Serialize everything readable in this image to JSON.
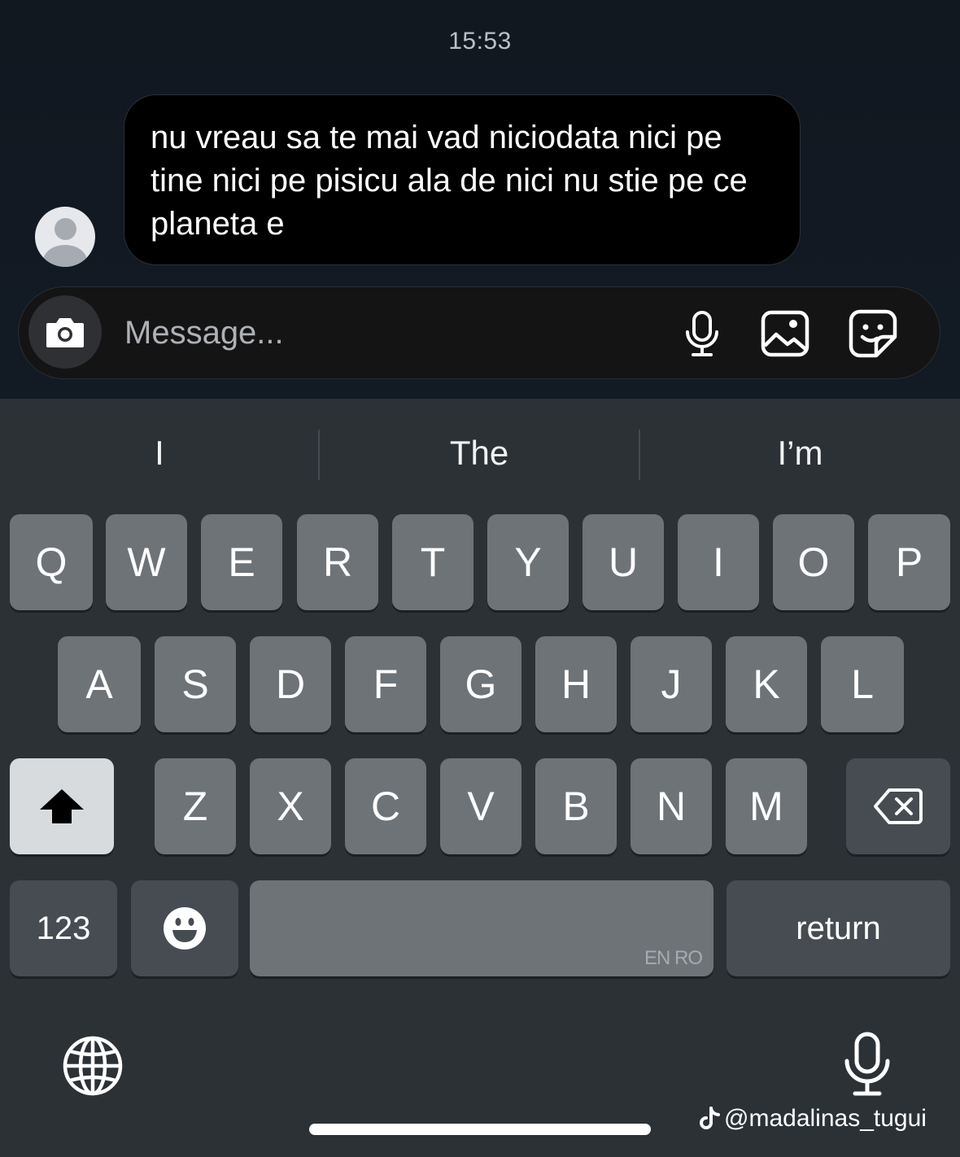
{
  "chat": {
    "timestamp": "15:53",
    "message_text": "nu vreau sa te mai vad niciodata nici pe tine nici pe pisicu ala de nici nu stie pe ce planeta e"
  },
  "composer": {
    "placeholder": "Message...",
    "icons": [
      "camera-icon",
      "microphone-icon",
      "image-icon",
      "sticker-icon"
    ]
  },
  "keyboard": {
    "suggestions": [
      "I",
      "The",
      "I’m"
    ],
    "row1": [
      "Q",
      "W",
      "E",
      "R",
      "T",
      "Y",
      "U",
      "I",
      "O",
      "P"
    ],
    "row2": [
      "A",
      "S",
      "D",
      "F",
      "G",
      "H",
      "J",
      "K",
      "L"
    ],
    "row3": [
      "Z",
      "X",
      "C",
      "V",
      "B",
      "N",
      "M"
    ],
    "numbers_label": "123",
    "space_language": "EN RO",
    "return_label": "return"
  },
  "watermark": "@madalinas_tugui",
  "colors": {
    "chat_bg": "#111820",
    "bubble_bg": "#000000",
    "keyboard_bg": "#2c3136",
    "key_bg": "#6e7378",
    "shift_active_bg": "#d8dbde"
  }
}
